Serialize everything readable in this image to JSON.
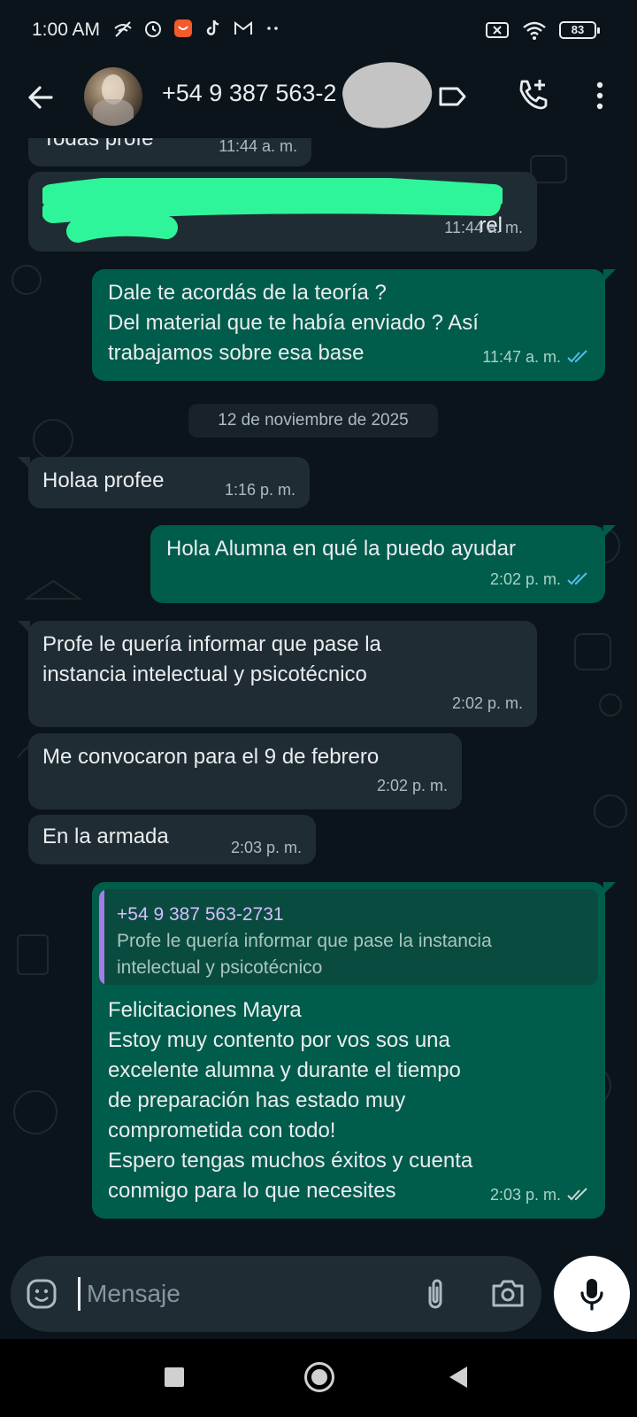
{
  "status_bar": {
    "time": "1:00 AM",
    "battery": "83",
    "icons": [
      "wifi-off-call-icon",
      "alarm-icon",
      "app-notification-icon",
      "tiktok-icon",
      "gmail-icon",
      "more-dots-icon",
      "sim-x-icon",
      "wifi-icon",
      "battery-icon"
    ]
  },
  "header": {
    "contact_name": "+54 9 387 563-2",
    "icons": [
      "back-arrow-icon",
      "label-icon",
      "add-call-icon",
      "more-vert-icon"
    ]
  },
  "messages": [
    {
      "direction": "in",
      "text": "Todas profe",
      "time": "11:44 a. m."
    },
    {
      "direction": "in",
      "text": "s\nrel",
      "time": "11:44 a. m."
    },
    {
      "direction": "out",
      "text": "Dale te acordás de la teoría ?\nDel material que te había enviado ? Así\ntrabajamos sobre esa base",
      "time": "11:47 a. m.",
      "status": "read"
    },
    {
      "direction": "in",
      "text": "Holaa profee",
      "time": "1:16 p. m."
    },
    {
      "direction": "out",
      "text": "Hola Alumna en qué la puedo ayudar",
      "time": "2:02 p. m.",
      "status": "read"
    },
    {
      "direction": "in",
      "text": "Profe le quería informar que pase la\ninstancia intelectual y psicotécnico",
      "time": "2:02 p. m."
    },
    {
      "direction": "in",
      "text": "Me convocaron para el 9 de febrero",
      "time": "2:02 p. m."
    },
    {
      "direction": "in",
      "text": "En la armada",
      "time": "2:03 p. m."
    },
    {
      "direction": "out",
      "quote": {
        "name": "+54 9 387 563-2731",
        "text": "Profe le quería informar que pase la instancia\nintelectual y psicotécnico"
      },
      "text": "Felicitaciones  Mayra\nEstoy muy contento por vos sos una\nexcelente alumna y durante el tiempo\nde preparación has estado muy\ncomprometida con todo!\nEspero tengas muchos éxitos y cuenta\nconmigo para lo que necesites",
      "time": "2:03 p. m.",
      "status": "delivered"
    }
  ],
  "date_separator": "12 de noviembre de 2025",
  "composer": {
    "placeholder": "Mensaje",
    "icons": [
      "emoji-icon",
      "attach-icon",
      "camera-icon",
      "mic-icon"
    ]
  },
  "colors": {
    "background": "#0b141a",
    "incoming_bubble": "#202c33",
    "outgoing_bubble": "#005c4b",
    "read_ticks": "#53bdeb",
    "redaction_green": "#2ff59a"
  }
}
